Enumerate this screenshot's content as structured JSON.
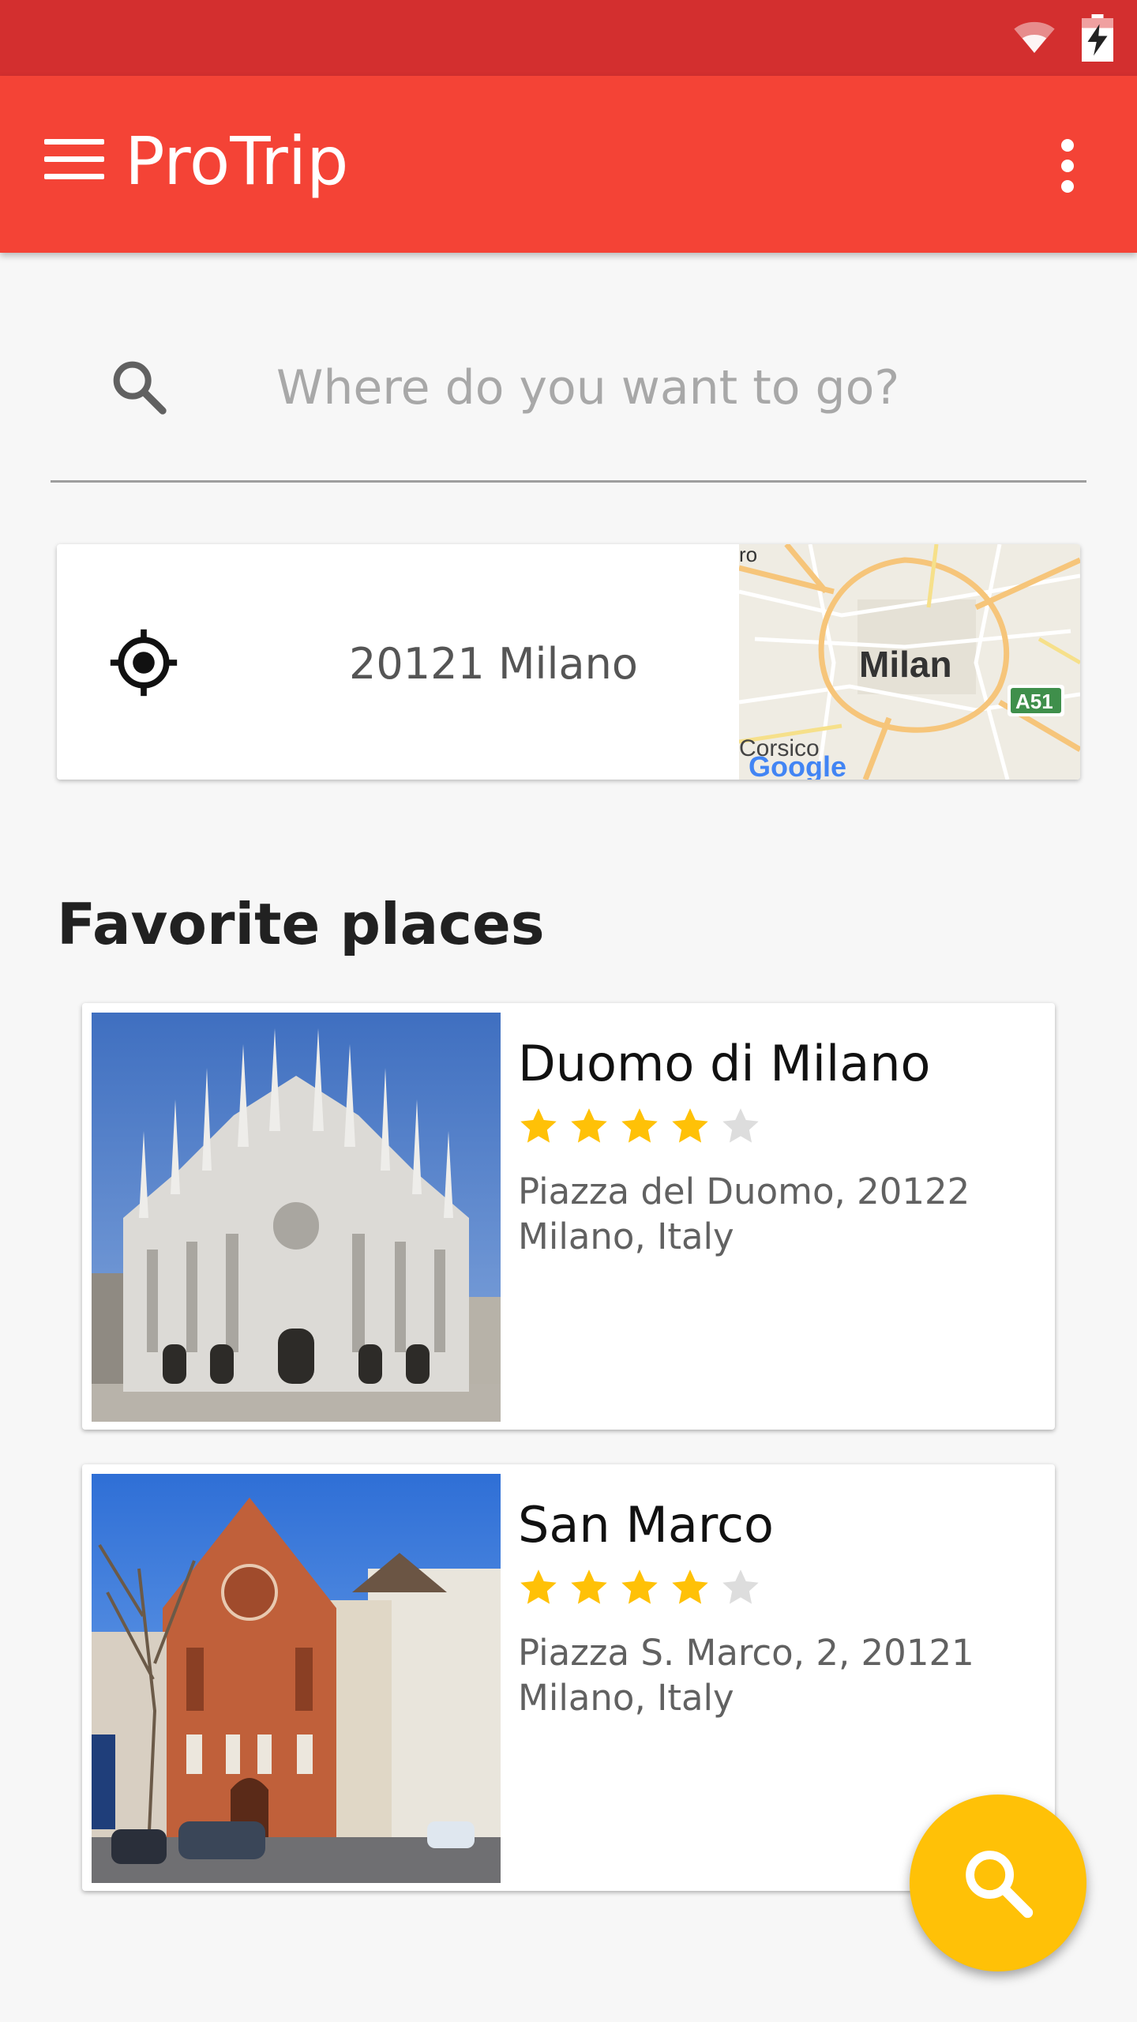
{
  "app": {
    "title": "ProTrip"
  },
  "search": {
    "placeholder": "Where do you want to go?",
    "value": ""
  },
  "location": {
    "text": "20121 Milano",
    "map": {
      "city_label": "Milan",
      "road_label": "A51",
      "town_label": "Corsico",
      "brand": "Google",
      "edge_label": "ro"
    }
  },
  "favorites": {
    "title": "Favorite places",
    "items": [
      {
        "name": "Duomo di Milano",
        "rating": 4.5,
        "address": "Piazza del Duomo, 20122 Milano, Italy"
      },
      {
        "name": "San Marco",
        "rating": 4.5,
        "address": "Piazza S. Marco, 2, 20121 Milano, Italy"
      }
    ]
  },
  "colors": {
    "status_bar": "#d32f2f",
    "app_bar": "#f44336",
    "fab": "#ffc107",
    "star": "#ffc107"
  },
  "icons": [
    "wifi-icon",
    "battery-charging-icon",
    "menu-icon",
    "more-vert-icon",
    "search-icon",
    "my-location-icon",
    "star-icon"
  ]
}
